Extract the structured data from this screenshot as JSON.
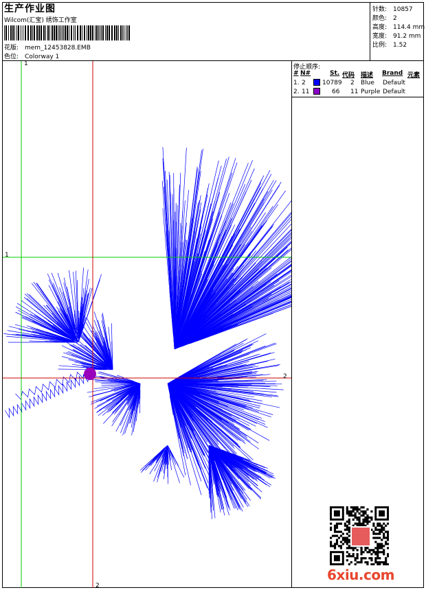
{
  "header": {
    "title": "生产作业图",
    "studio": "Wilcom(汇宝) 绣饰工作室",
    "design_label": "花版:",
    "design_value": "mem_12453828.EMB",
    "colorway_label": "色位:",
    "colorway_value": "Colorway 1"
  },
  "stats": {
    "stitches_label": "针数:",
    "stitches_value": "10857",
    "colors_label": "颜色:",
    "colors_value": "2",
    "height_label": "高度:",
    "height_value": "114.4 mm",
    "width_label": "宽度:",
    "width_value": "91.2 mm",
    "scale_label": "比例:",
    "scale_value": "1.52"
  },
  "stop_sequence": {
    "title": "停止顺序:",
    "columns": [
      "#",
      "N#",
      "St.",
      "代码",
      "描述",
      "Brand",
      "元素"
    ],
    "rows": [
      {
        "idx": "1.",
        "n": "2",
        "st": "10789",
        "code": "2",
        "desc": "Blue",
        "brand": "Default",
        "color": "#0000ff"
      },
      {
        "idx": "2.",
        "n": "11",
        "st": "66",
        "code": "11",
        "desc": "Purple",
        "brand": "Default",
        "color": "#8b00c8"
      }
    ]
  },
  "guides": {
    "green_v": "1",
    "green_h": "1",
    "red_h": "2",
    "red_v": "2"
  },
  "colors": {
    "thread_blue": "#0000ff",
    "thread_purple": "#9900bb",
    "guide_green": "#00cc00",
    "guide_red": "#cc0000"
  },
  "watermark": "6xiu.com"
}
